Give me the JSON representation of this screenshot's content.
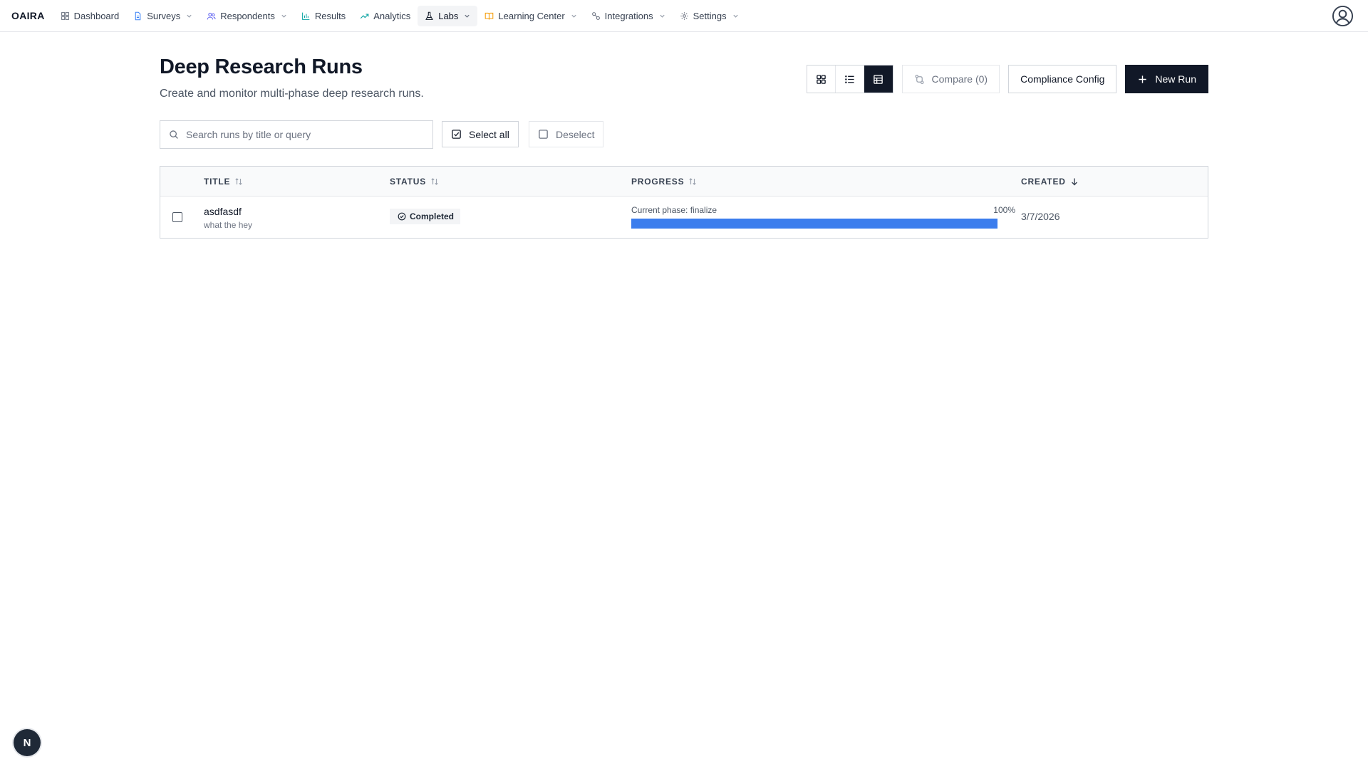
{
  "app": {
    "logo": "OAIRA"
  },
  "nav": [
    {
      "label": "Dashboard",
      "icon": "dashboard-icon",
      "has_menu": false,
      "active": false
    },
    {
      "label": "Surveys",
      "icon": "document-icon",
      "has_menu": true,
      "active": false
    },
    {
      "label": "Respondents",
      "icon": "users-icon",
      "has_menu": true,
      "active": false
    },
    {
      "label": "Results",
      "icon": "bar-chart-icon",
      "has_menu": false,
      "active": false
    },
    {
      "label": "Analytics",
      "icon": "trend-up-icon",
      "has_menu": false,
      "active": false
    },
    {
      "label": "Labs",
      "icon": "flask-icon",
      "has_menu": true,
      "active": true
    },
    {
      "label": "Learning Center",
      "icon": "book-icon",
      "has_menu": true,
      "active": false
    },
    {
      "label": "Integrations",
      "icon": "link-icon",
      "has_menu": true,
      "active": false
    },
    {
      "label": "Settings",
      "icon": "gear-icon",
      "has_menu": true,
      "active": false
    }
  ],
  "page": {
    "title": "Deep Research Runs",
    "subtitle": "Create and monitor multi-phase deep research runs."
  },
  "toolbar": {
    "views": [
      "grid-view-icon",
      "list-view-icon",
      "table-view-icon"
    ],
    "active_view": "table",
    "compare_label": "Compare (0)",
    "compliance_label": "Compliance Config",
    "new_run_label": "New Run"
  },
  "search": {
    "placeholder": "Search runs by title or query",
    "value": ""
  },
  "selection": {
    "select_all_label": "Select all",
    "deselect_label": "Deselect"
  },
  "table": {
    "headers": {
      "title": "TITLE",
      "status": "STATUS",
      "progress": "PROGRESS",
      "created": "CREATED"
    },
    "rows": [
      {
        "title": "asdfasdf",
        "query": "what the hey",
        "status": "Completed",
        "phase": "Current phase: finalize",
        "progress_text": "100%",
        "progress": 1.0,
        "created": "3/7/2026"
      }
    ]
  },
  "colors": {
    "accent": "#3b7ded",
    "primary": "#111827",
    "learning_icon": "#f59e0b",
    "nav_icon": "#0ea5a4"
  },
  "fab": {
    "letter": "N"
  }
}
